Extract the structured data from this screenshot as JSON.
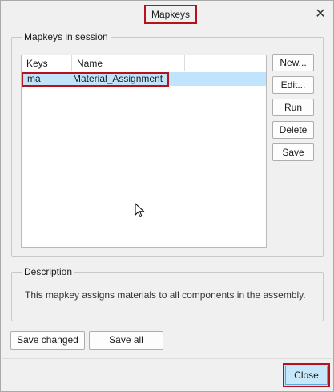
{
  "window": {
    "title": "Mapkeys",
    "close_glyph": "✕"
  },
  "session_group": {
    "legend": "Mapkeys in session",
    "columns": [
      "Keys",
      "Name"
    ],
    "rows": [
      {
        "key": "ma",
        "name": "Material_Assignment",
        "selected": true
      }
    ]
  },
  "side_buttons": {
    "new": "New...",
    "edit": "Edit...",
    "run": "Run",
    "delete": "Delete",
    "save": "Save"
  },
  "description_group": {
    "legend": "Description",
    "text": "This mapkey assigns materials to all components in the assembly."
  },
  "bottom_buttons": {
    "save_changed": "Save changed",
    "save_all": "Save all"
  },
  "footer": {
    "close": "Close"
  },
  "colors": {
    "highlight_border": "#b5121b",
    "selection": "#bfe4fb",
    "background": "#f0f0f0"
  },
  "icons": {
    "cursor": "mouse-pointer-icon",
    "close": "close-icon"
  }
}
